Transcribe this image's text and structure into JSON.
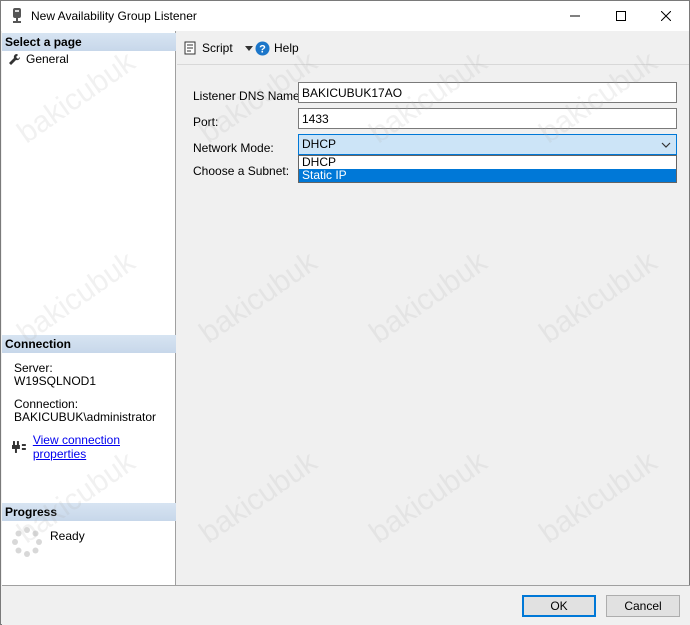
{
  "window": {
    "title": "New Availability Group Listener"
  },
  "left_pane": {
    "select_page_header": "Select a page",
    "pages": [
      {
        "label": "General",
        "icon": "wrench-icon"
      }
    ],
    "connection_header": "Connection",
    "server_label": "Server:",
    "server_value": "W19SQLNOD1",
    "connection_label": "Connection:",
    "connection_value": "BAKICUBUK\\administrator",
    "view_connection_link": "View connection properties",
    "progress_header": "Progress",
    "progress_status": "Ready"
  },
  "toolbar": {
    "script_label": "Script",
    "help_label": "Help"
  },
  "form": {
    "dns_label": "Listener DNS Name:",
    "dns_value": "BAKICUBUK17AO",
    "port_label": "Port:",
    "port_value": "1433",
    "network_mode_label": "Network Mode:",
    "network_mode_value": "DHCP",
    "network_mode_options": [
      "DHCP",
      "Static IP"
    ],
    "network_mode_highlighted": "Static IP",
    "subnet_label": "Choose a Subnet:"
  },
  "buttons": {
    "ok_label": "OK",
    "cancel_label": "Cancel"
  },
  "watermark_text": "bakicubuk",
  "colors": {
    "accent": "#0078d7",
    "header_band": "#c7d7ea",
    "link": "#0000ee"
  }
}
